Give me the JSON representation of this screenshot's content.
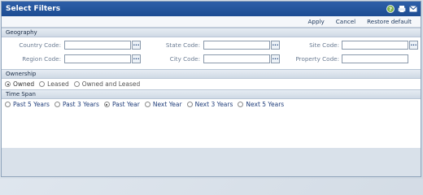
{
  "window": {
    "title": "Select Filters",
    "icons": [
      "help-icon",
      "print-icon",
      "close-icon"
    ]
  },
  "toolbar": {
    "apply": "Apply",
    "cancel": "Cancel",
    "restore": "Restore default"
  },
  "geography": {
    "header": "Geography",
    "country_label": "Country Code:",
    "state_label": "State Code:",
    "site_label": "Site Code:",
    "region_label": "Region Code:",
    "city_label": "City Code:",
    "property_label": "Property Code:",
    "picker_text": "..."
  },
  "ownership": {
    "header": "Ownership",
    "options": [
      "Owned",
      "Leased",
      "Owned and Leased"
    ],
    "selected": "Owned"
  },
  "timespan": {
    "header": "Time Span",
    "options": [
      "Past 5 Years",
      "Past 3 Years",
      "Past Year",
      "Next Year",
      "Next 3 Years",
      "Next 5 Years"
    ],
    "selected": "Past Year"
  }
}
